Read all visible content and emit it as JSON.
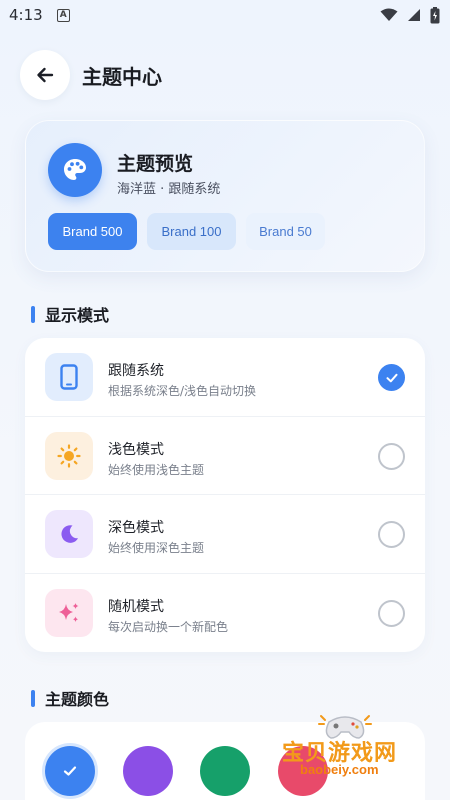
{
  "status_bar": {
    "time": "4:13",
    "notification_badge": "A"
  },
  "header": {
    "title": "主题中心"
  },
  "preview": {
    "title": "主题预览",
    "subtitle": "海洋蓝 · 跟随系统",
    "chips": [
      "Brand 500",
      "Brand 100",
      "Brand 50"
    ]
  },
  "display_mode": {
    "section_title": "显示模式",
    "items": [
      {
        "label": "跟随系统",
        "desc": "根据系统深色/浅色自动切换",
        "icon": "phone-icon",
        "selected": true
      },
      {
        "label": "浅色模式",
        "desc": "始终使用浅色主题",
        "icon": "sun-icon",
        "selected": false
      },
      {
        "label": "深色模式",
        "desc": "始终使用深色主题",
        "icon": "moon-icon",
        "selected": false
      },
      {
        "label": "随机模式",
        "desc": "每次启动换一个新配色",
        "icon": "sparkle-icon",
        "selected": false
      }
    ]
  },
  "theme_color": {
    "section_title": "主题颜色",
    "swatches": [
      "#3c82f0",
      "#8b4fe6",
      "#16a06a",
      "#e84a6a"
    ],
    "selected_index": 0
  },
  "watermark": {
    "text": "宝贝游戏网",
    "url": "baobeiy.com"
  },
  "colors": {
    "accent": "#3c82f0"
  }
}
